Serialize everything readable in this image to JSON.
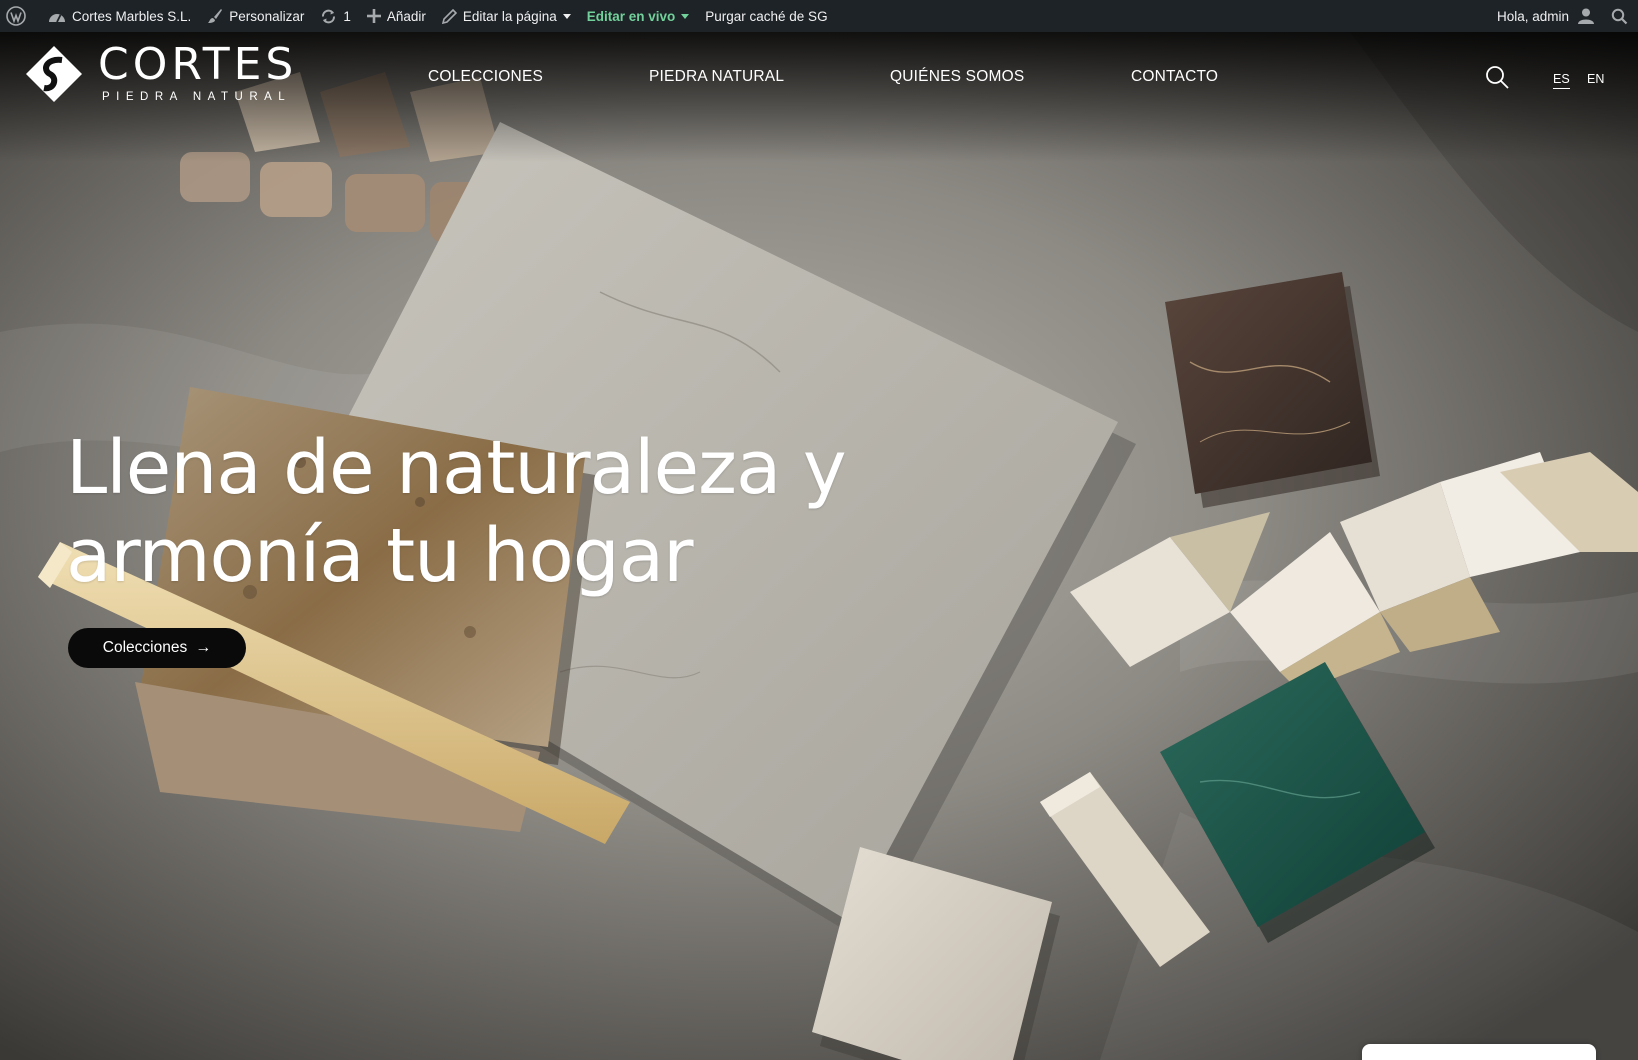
{
  "admin_bar": {
    "site_name": "Cortes Marbles S.L.",
    "customize": "Personalizar",
    "updates_count": "1",
    "add_new": "Añadir",
    "edit_page": "Editar la página",
    "edit_live": "Editar en vivo",
    "purge_cache": "Purgar caché de SG",
    "greeting": "Hola, admin",
    "edit_live_color": "#72d19a",
    "bar_color": "#1d2327"
  },
  "header": {
    "logo": {
      "brand": "CORTES",
      "tagline": "PIEDRA NATURAL"
    },
    "nav": [
      {
        "label": "COLECCIONES"
      },
      {
        "label": "PIEDRA NATURAL"
      },
      {
        "label": "QUIÉNES SOMOS"
      },
      {
        "label": "CONTACTO"
      }
    ],
    "languages": [
      {
        "code": "ES",
        "active": true
      },
      {
        "code": "EN",
        "active": false
      }
    ]
  },
  "hero": {
    "headline_line1": "Llena de naturaleza y",
    "headline_line2": "armonía tu hogar",
    "cta_label": "Colecciones",
    "cta_arrow": "→"
  },
  "icons": {
    "wp": "wordpress-logo-icon",
    "site": "dashboard-icon",
    "customize": "brush-icon",
    "updates": "refresh-icon",
    "add": "plus-icon",
    "edit": "pencil-icon",
    "user": "user-avatar-icon",
    "search": "search-icon"
  }
}
